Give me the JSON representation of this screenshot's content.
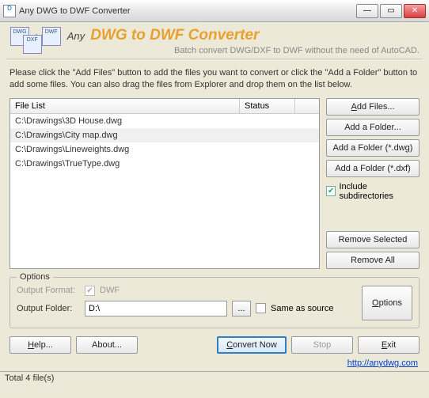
{
  "window": {
    "title": "Any DWG to DWF Converter"
  },
  "header": {
    "any": "Any",
    "title": "DWG to DWF Converter",
    "subtitle": "Batch convert DWG/DXF to DWF without the need of AutoCAD."
  },
  "intro": "Please click the \"Add Files\" button to add the files you want to convert or click the \"Add a Folder\" button to add some files. You can also drag the files from Explorer and drop them on the list below.",
  "list": {
    "headers": {
      "file": "File List",
      "status": "Status"
    },
    "rows": [
      "C:\\Drawings\\3D House.dwg",
      "C:\\Drawings\\City map.dwg",
      "C:\\Drawings\\Lineweights.dwg",
      "C:\\Drawings\\TrueType.dwg"
    ]
  },
  "side": {
    "add_files": "Add Files...",
    "add_folder": "Add a Folder...",
    "add_folder_dwg": "Add a Folder (*.dwg)",
    "add_folder_dxf": "Add a Folder (*.dxf)",
    "include_sub": "Include subdirectories",
    "remove_selected": "Remove Selected",
    "remove_all": "Remove All"
  },
  "options": {
    "legend": "Options",
    "output_format_lbl": "Output Format:",
    "dwf_lbl": "DWF",
    "output_folder_lbl": "Output Folder:",
    "output_folder_val": "D:\\",
    "same_as_source": "Same as source",
    "browse": "...",
    "options_btn": "Options"
  },
  "bottom": {
    "help": "Help...",
    "about": "About...",
    "convert": "Convert Now",
    "stop": "Stop",
    "exit": "Exit"
  },
  "link": "http://anydwg.com",
  "status": "Total 4 file(s)"
}
